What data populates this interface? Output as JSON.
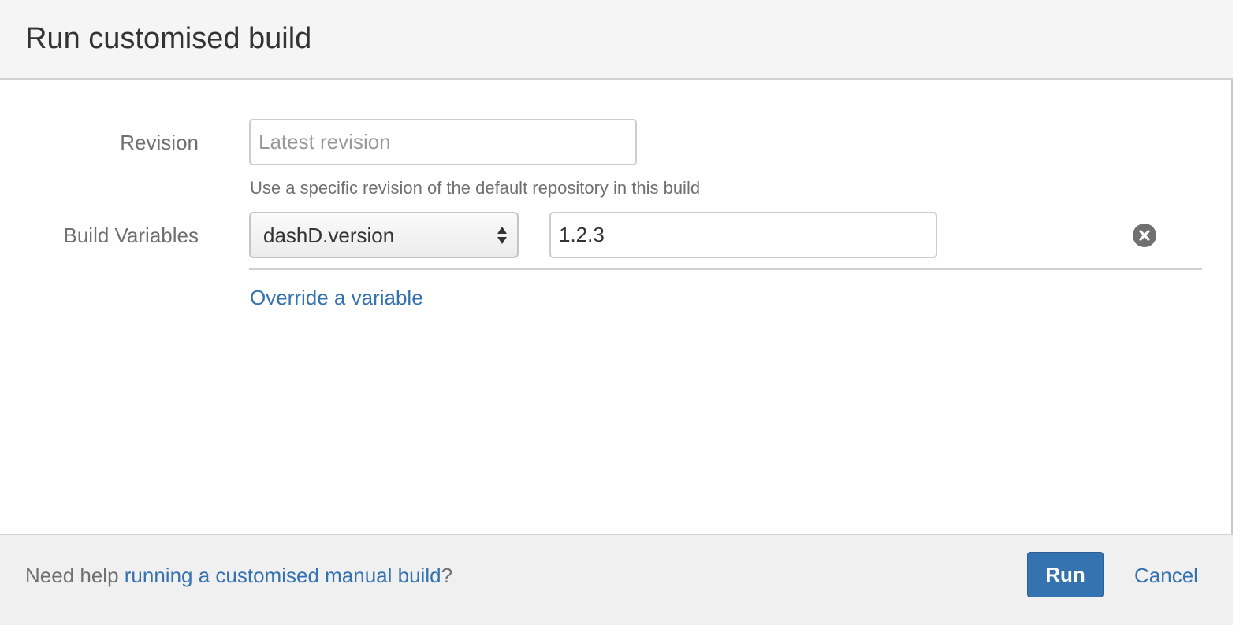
{
  "dialog": {
    "title": "Run customised build"
  },
  "revision": {
    "label": "Revision",
    "placeholder": "Latest revision",
    "value": "",
    "hint": "Use a specific revision of the default repository in this build"
  },
  "build_variables": {
    "label": "Build Variables",
    "rows": [
      {
        "name": "dashD.version",
        "value": "1.2.3",
        "remove_icon": "remove-circle-icon"
      }
    ],
    "override_link": "Override a variable"
  },
  "footer": {
    "help_prefix": "Need help ",
    "help_link": "running a customised manual build",
    "help_suffix": "?",
    "run_label": "Run",
    "cancel_label": "Cancel"
  },
  "colors": {
    "accent": "#3572b0",
    "header_bg": "#f5f5f5",
    "footer_bg": "#f0f0f0",
    "label_text": "#707070"
  }
}
